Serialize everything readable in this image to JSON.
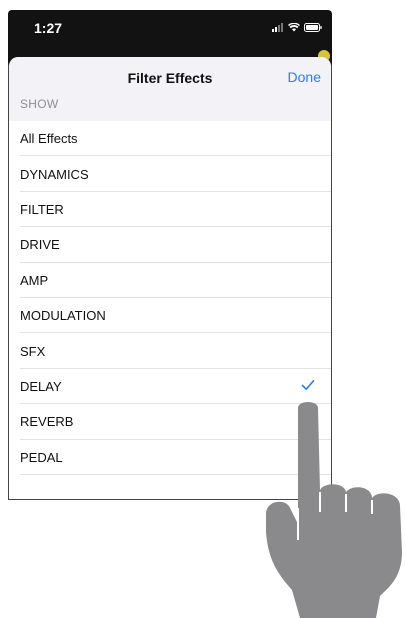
{
  "status_bar": {
    "time": "1:27"
  },
  "sheet": {
    "title": "Filter Effects",
    "done_label": "Done",
    "section_label": "SHOW"
  },
  "items": [
    {
      "label": "All Effects",
      "checked": false
    },
    {
      "label": "DYNAMICS",
      "checked": false
    },
    {
      "label": "FILTER",
      "checked": false
    },
    {
      "label": "DRIVE",
      "checked": false
    },
    {
      "label": "AMP",
      "checked": false
    },
    {
      "label": "MODULATION",
      "checked": false
    },
    {
      "label": "SFX",
      "checked": false
    },
    {
      "label": "DELAY",
      "checked": true
    },
    {
      "label": "REVERB",
      "checked": false
    },
    {
      "label": "PEDAL",
      "checked": false
    }
  ],
  "colors": {
    "accent": "#2f7bf5",
    "hand": "#8a8a8d"
  },
  "icons": {
    "check": "checkmark-icon",
    "pointer": "pointing-hand-icon"
  }
}
